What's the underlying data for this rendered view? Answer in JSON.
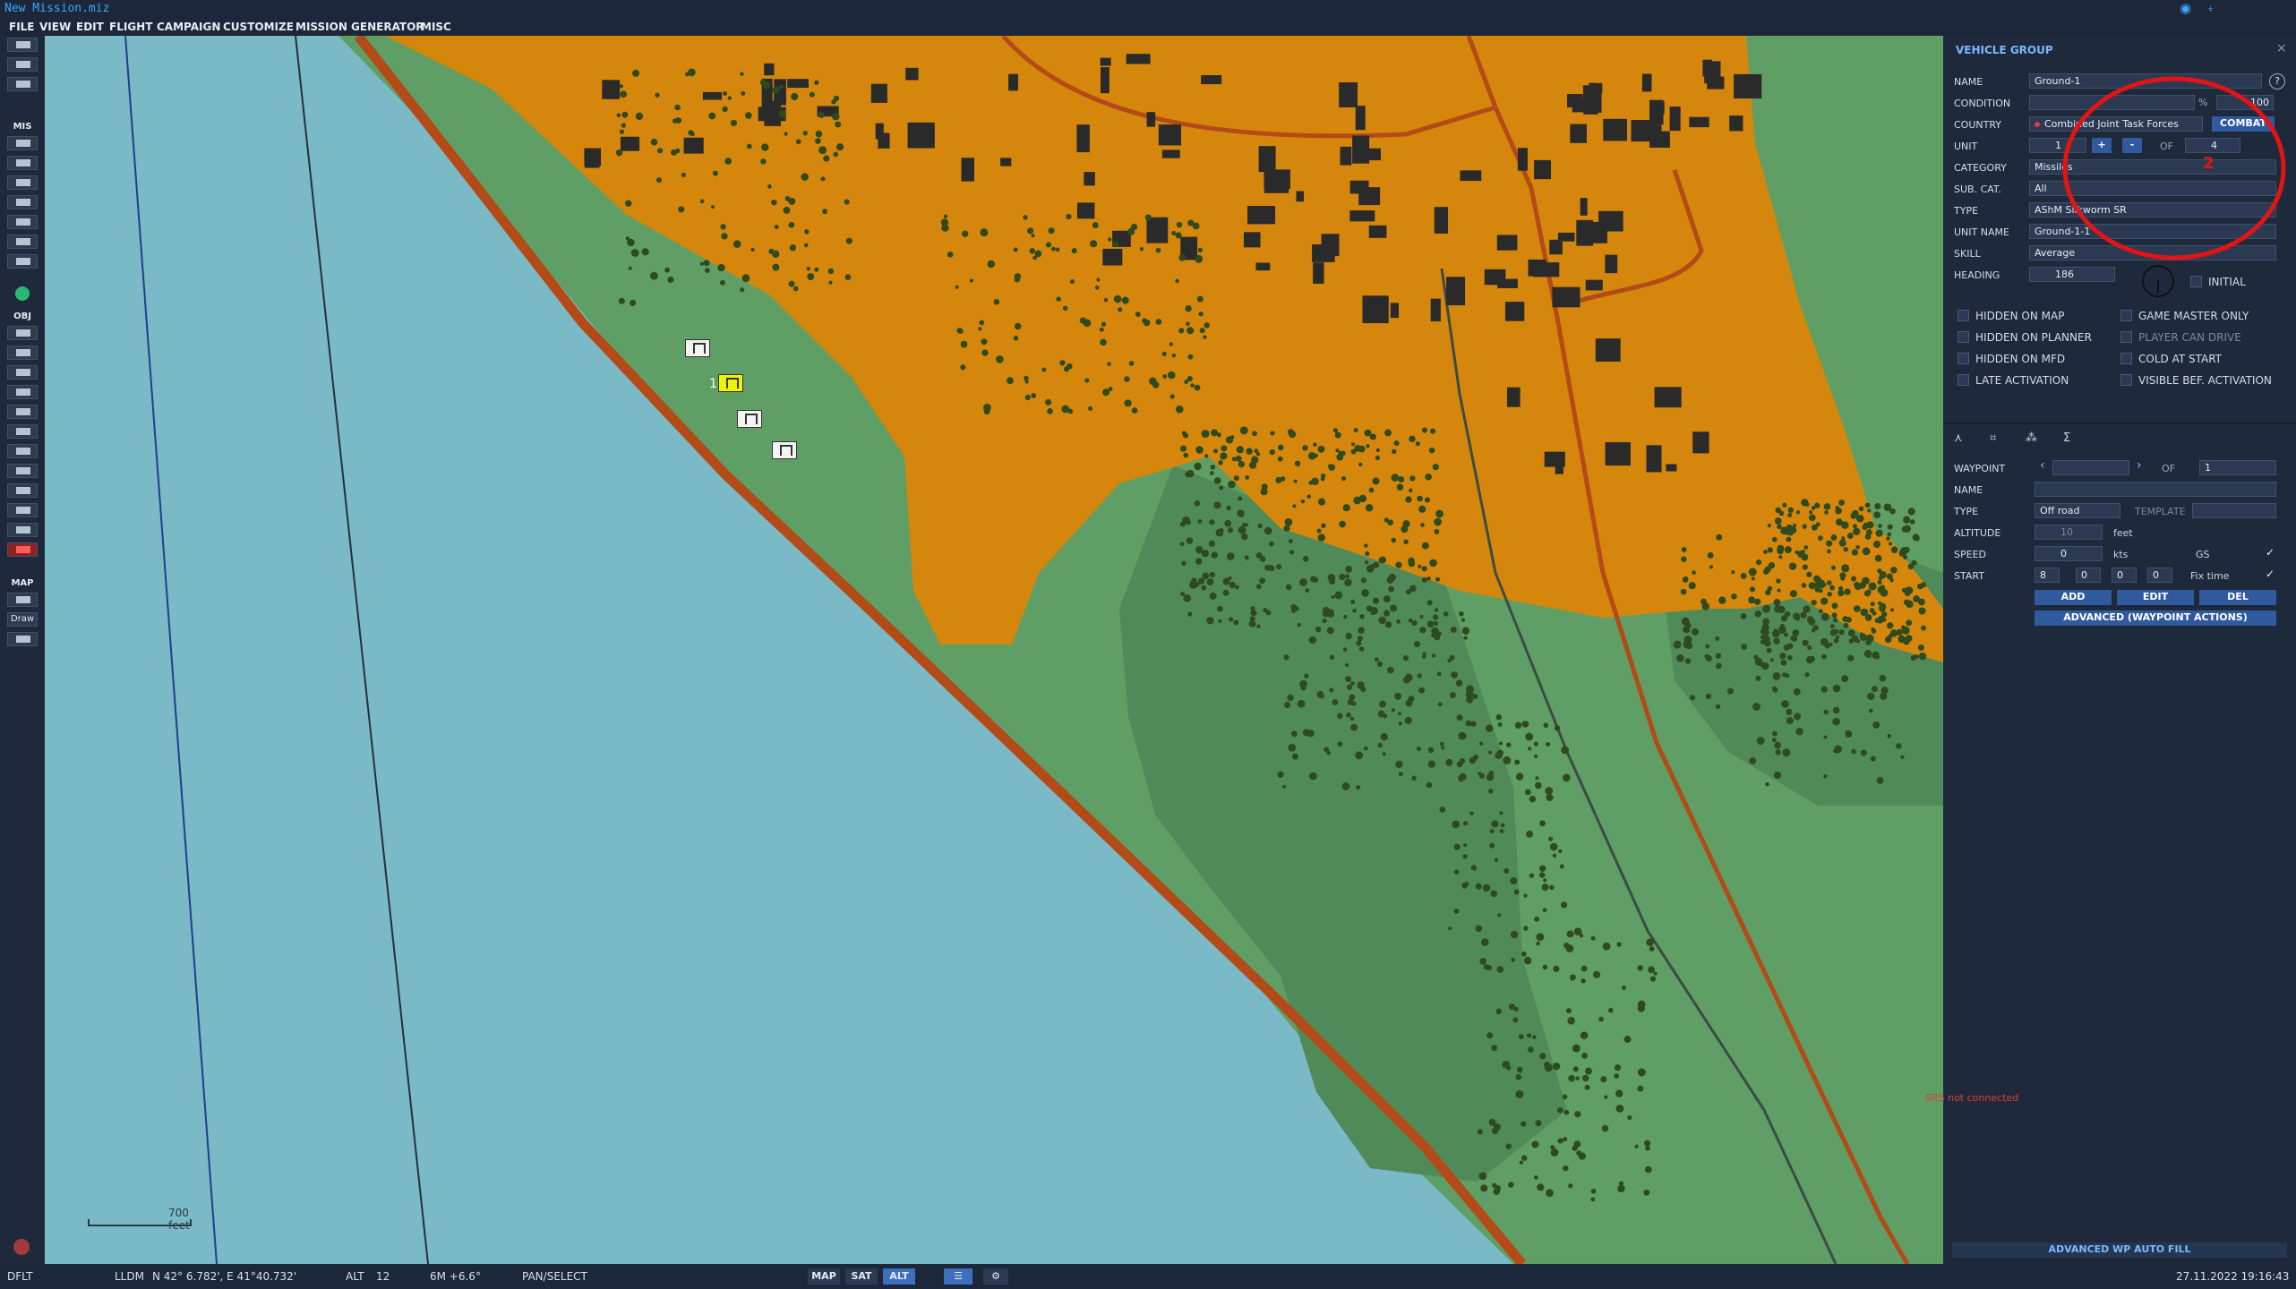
{
  "window": {
    "title": "New Mission.miz",
    "wifi_icon": "wifi-icon",
    "antenna_icon": "antenna-icon"
  },
  "menu": [
    "FILE",
    "VIEW",
    "EDIT",
    "FLIGHT",
    "CAMPAIGN",
    "CUSTOMIZE",
    "MISSION GENERATOR",
    "MISC"
  ],
  "toolbar": {
    "mis_label": "MIS",
    "obj_label": "OBJ",
    "map_label": "MAP",
    "draw_label": "Draw"
  },
  "map": {
    "scale_label": "700 feet",
    "waypoint_number": "1"
  },
  "panel": {
    "title": "VEHICLE GROUP",
    "help": "?",
    "close": "×",
    "annotation": "2",
    "name_label": "NAME",
    "name_value": "Ground-1",
    "condition_label": "CONDITION",
    "condition_value": "",
    "condition_unit": "%",
    "condition_right": "100",
    "country_label": "COUNTRY",
    "country_value": "Combined Joint Task Forces",
    "combat_btn": "COMBAT",
    "unit_label": "UNIT",
    "unit_value": "1",
    "unit_plus": "+",
    "unit_minus": "-",
    "unit_of": "OF",
    "unit_total": "4",
    "category_label": "CATEGORY",
    "category_value": "Missiles",
    "subcat_label": "SUB. CAT.",
    "subcat_value": "All",
    "type_label": "TYPE",
    "type_value": "AShM Silkworm SR",
    "unitname_label": "UNIT NAME",
    "unitname_value": "Ground-1-1",
    "skill_label": "SKILL",
    "skill_value": "Average",
    "heading_label": "HEADING",
    "heading_value": "186",
    "initial_label": "INITIAL",
    "checks_left": [
      "HIDDEN ON MAP",
      "HIDDEN ON PLANNER",
      "HIDDEN ON MFD",
      "LATE ACTIVATION"
    ],
    "checks_right": [
      "GAME MASTER ONLY",
      "PLAYER CAN DRIVE",
      "COLD AT START",
      "VISIBLE BEF. ACTIVATION"
    ],
    "tabs_icons": [
      "route-icon",
      "target-icon",
      "triggered-actions-icon",
      "summary-icon"
    ],
    "tab_sigma": "Σ",
    "waypoint_label": "WAYPOINT",
    "waypoint_value": "",
    "waypoint_of": "OF",
    "waypoint_total": "1",
    "wp_name_label": "NAME",
    "wp_name_value": "",
    "wp_type_label": "TYPE",
    "wp_type_value": "Off road",
    "template_label": "TEMPLATE",
    "template_value": "",
    "altitude_label": "ALTITUDE",
    "altitude_value": "10",
    "altitude_unit": "feet",
    "speed_label": "SPEED",
    "speed_value": "0",
    "speed_unit": "kts",
    "gs_label": "GS",
    "start_label": "START",
    "start_h": "8",
    "start_m": "0",
    "start_s": "0",
    "start_d": "0",
    "fixtime_label": "Fix time",
    "add_btn": "ADD",
    "edit_btn": "EDIT",
    "del_btn": "DEL",
    "advanced_btn": "ADVANCED (WAYPOINT ACTIONS)",
    "not_connected": "SRS not connected",
    "autofill_btn": "ADVANCED WP AUTO FILL"
  },
  "status": {
    "dflt": "DFLT",
    "coord_mode": "LLDM",
    "coords": "N 42° 6.782', E 41°40.732'",
    "alt_label": "ALT",
    "alt_value": "12",
    "magvar": "6M  +6.6°",
    "mode": "PAN/SELECT",
    "map_btn": "MAP",
    "sat_btn": "SAT",
    "alt_btn": "ALT",
    "datetime": "27.11.2022 19:16:43"
  },
  "colors": {
    "sea": "#7ab9c6",
    "land": "#5f9e65",
    "forest_area": "#4f8a58",
    "urban": "#d4870c",
    "road": "#b34a17",
    "highlight": "#e21414"
  }
}
